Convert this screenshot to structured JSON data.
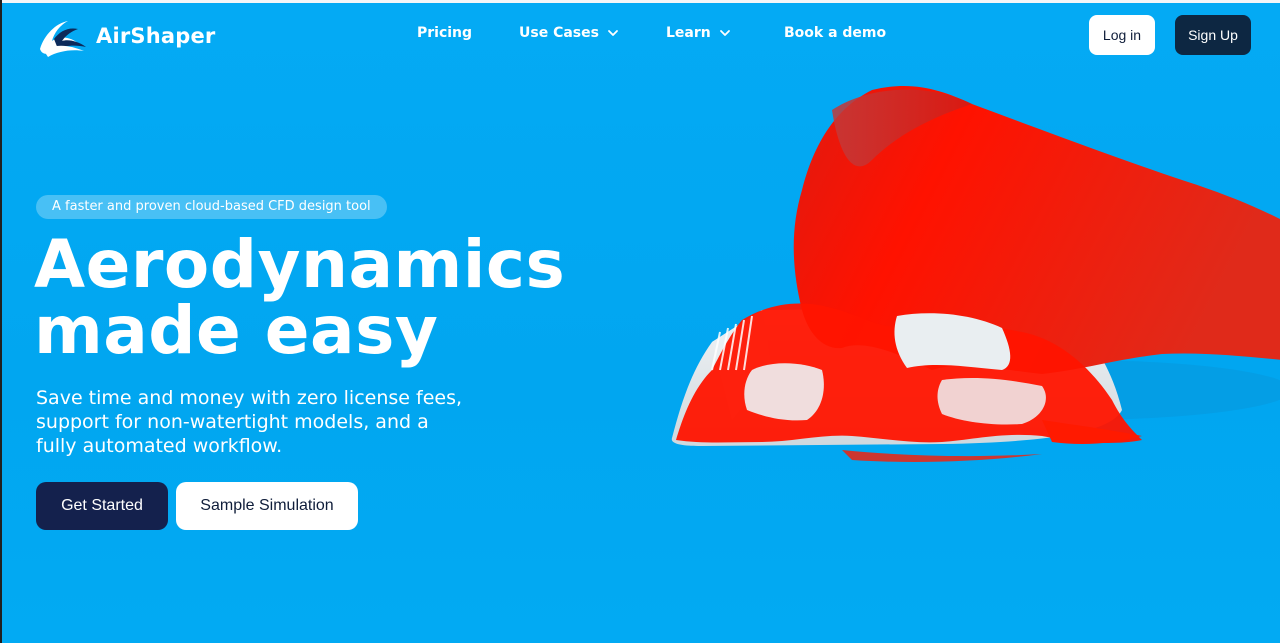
{
  "brand": {
    "name": "AirShaper",
    "logo_icon": "airshaper-wave-icon",
    "colors": {
      "background": "#02a8f3",
      "dark_navy": "#14214d",
      "signup_bg": "#0d2742",
      "flow_red": "#ff1a00"
    }
  },
  "nav": {
    "items": [
      {
        "label": "Pricing",
        "has_dropdown": false
      },
      {
        "label": "Use Cases",
        "has_dropdown": true
      },
      {
        "label": "Learn",
        "has_dropdown": true
      },
      {
        "label": "Book a demo",
        "has_dropdown": false
      }
    ],
    "login_label": "Log in",
    "signup_label": "Sign Up"
  },
  "hero": {
    "badge": "A faster and proven cloud-based CFD design tool",
    "title_line1": "Aerodynamics",
    "title_line2": "made easy",
    "subtitle_line1": "Save time and money with zero license fees,",
    "subtitle_line2": "support for non-watertight models, and a",
    "subtitle_line3": "fully automated workflow.",
    "primary_cta": "Get Started",
    "secondary_cta": "Sample Simulation"
  }
}
